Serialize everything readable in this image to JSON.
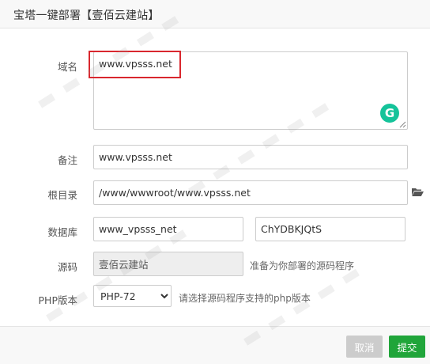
{
  "dialog": {
    "title": "宝塔一键部署【壹佰云建站】"
  },
  "form": {
    "domain": {
      "label": "域名",
      "value": "www.vpsss.net"
    },
    "remark": {
      "label": "备注",
      "value": "www.vpsss.net"
    },
    "root": {
      "label": "根目录",
      "value": "/www/wwwroot/www.vpsss.net"
    },
    "database": {
      "label": "数据库",
      "name_value": "www_vpsss_net",
      "password_value": "ChYDBKJQtS"
    },
    "source": {
      "label": "源码",
      "value": "壹佰云建站",
      "hint": "准备为你部署的源码程序"
    },
    "php": {
      "label": "PHP版本",
      "selected": "PHP-72",
      "hint": "请选择源码程序支持的php版本"
    }
  },
  "footer": {
    "cancel_label": "取消",
    "submit_label": "提交"
  },
  "colors": {
    "highlight": "#d9272e",
    "submit": "#20a53a",
    "cancel": "#cccccc",
    "grammarly": "#15c39a"
  },
  "icons": {
    "grammarly": "grammarly-icon",
    "folder": "folder-open-icon"
  }
}
